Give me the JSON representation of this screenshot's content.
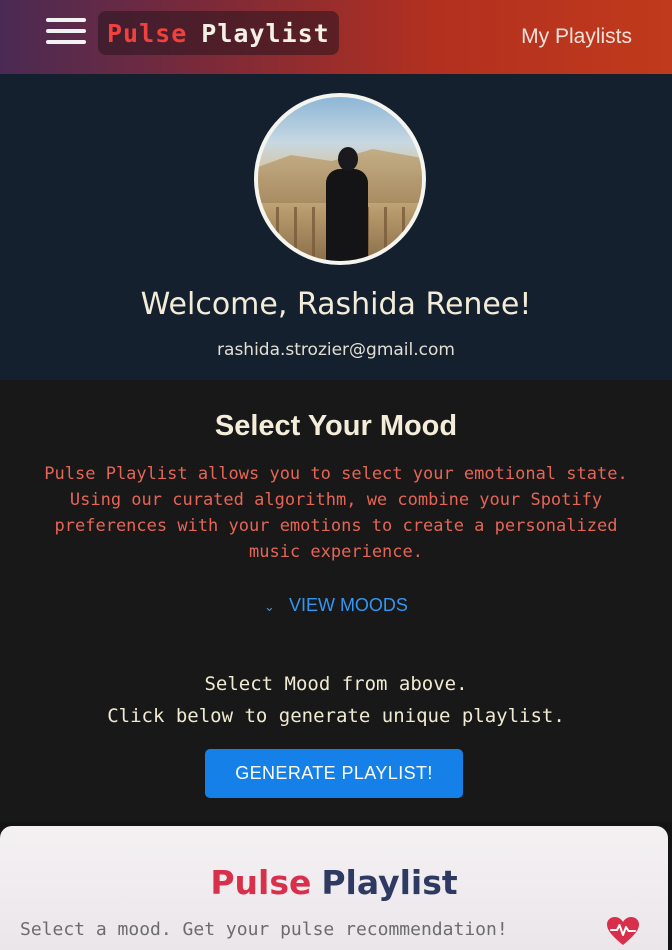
{
  "header": {
    "brand_part1": "Pulse",
    "brand_part2": "Playlist",
    "nav_link": "My Playlists",
    "icons": {
      "menu": "hamburger-menu-icon"
    }
  },
  "profile": {
    "welcome": "Welcome, Rashida Renee!",
    "email": "rashida.strozier@gmail.com"
  },
  "mood": {
    "title": "Select Your Mood",
    "description": "Pulse Playlist allows you to select your emotional state. Using our curated algorithm, we combine your Spotify preferences with your emotions to create a personalized music experience.",
    "view_moods_label": "VIEW MOODS",
    "hint_line1": "Select Mood from above.",
    "hint_line2": "Click below to generate unique playlist.",
    "generate_button": "GENERATE PLAYLIST!"
  },
  "footer": {
    "brand_part1": "Pulse",
    "brand_part2": "Playlist",
    "tagline": "Select a mood. Get your pulse recommendation!",
    "icons": {
      "heart": "heart-pulse-icon"
    }
  },
  "colors": {
    "accent_red": "#f0423d",
    "link_blue": "#3596f2",
    "button_blue": "#1480e8",
    "description_coral": "#e66557",
    "footer_red": "#d8304a",
    "footer_navy": "#2f3a62"
  }
}
